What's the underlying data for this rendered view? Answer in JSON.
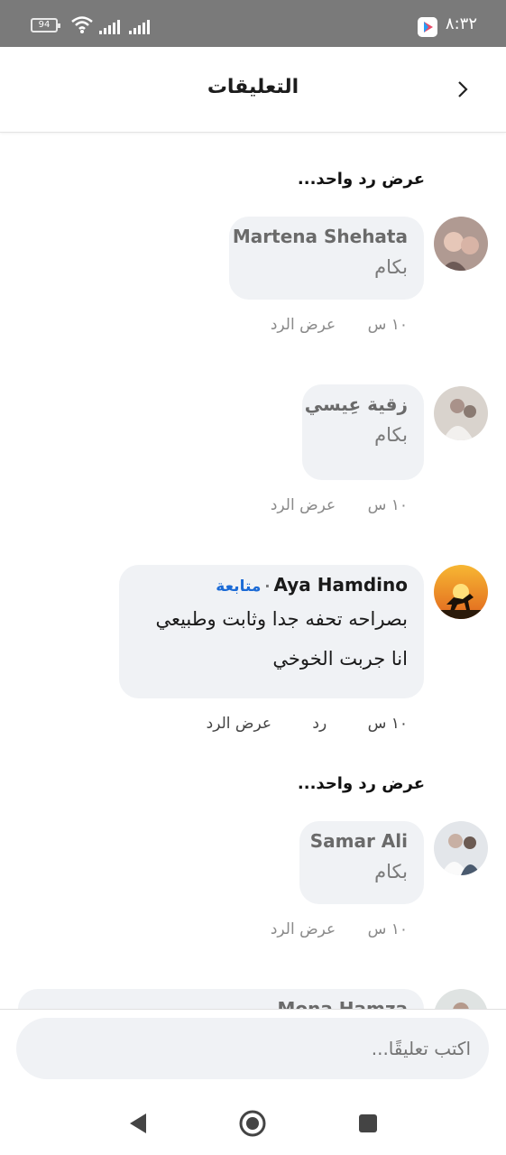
{
  "status_bar": {
    "battery": "94",
    "time": "٨:٣٢"
  },
  "header": {
    "title": "التعليقات"
  },
  "comments": [
    {
      "view_replies_label": "عرض رد واحد...",
      "name": "Martena Shehata",
      "text": "بكام",
      "time": "١٠ س",
      "action_view": "عرض الرد"
    },
    {
      "name": "زقية عِيسي",
      "text": "بكام",
      "time": "١٠ س",
      "action_view": "عرض الرد"
    },
    {
      "name": "Aya Hamdino",
      "follow": "متابعة",
      "text_line1": "بصراحه تحفه جدا وثابت وطبيعي",
      "text_line2": "انا جربت الخوخي",
      "time": "١٠ س",
      "action_reply": "رد",
      "action_view": "عرض الرد"
    },
    {
      "view_replies_label": "عرض رد واحد...",
      "name": "Samar Ali",
      "text": "بكام",
      "time": "١٠ س",
      "action_view": "عرض الرد"
    },
    {
      "name": "Mona Hamza"
    }
  ],
  "composer": {
    "placeholder": "اكتب تعليقًا..."
  },
  "colors": {
    "follow_link": "#1c6bd6",
    "bubble_bg": "#f0f2f5",
    "status_bar": "#7a7a7a"
  }
}
